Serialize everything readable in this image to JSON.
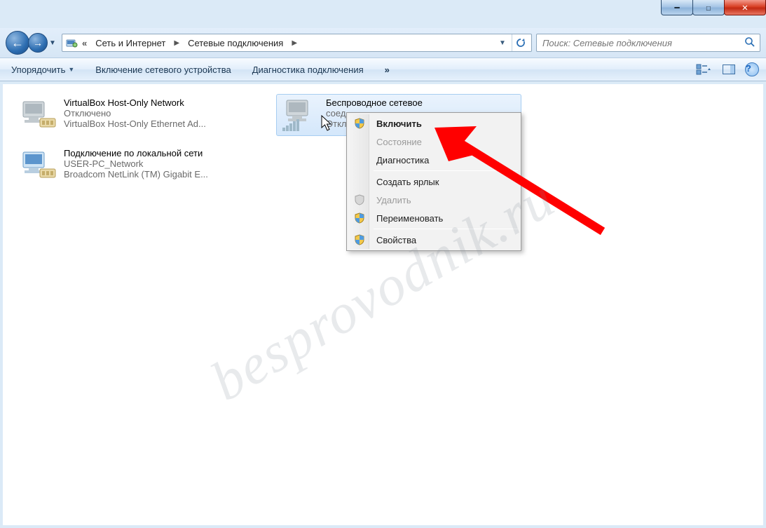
{
  "watermark": "besprovodnik.ru",
  "winctrls": {
    "min": "━",
    "max": "☐",
    "close": "✕"
  },
  "nav": {
    "back_glyph": "←",
    "fwd_glyph": "→",
    "chevrons": "«",
    "crumb1": "Сеть и Интернет",
    "crumb2": "Сетевые подключения"
  },
  "search": {
    "placeholder": "Поиск: Сетевые подключения"
  },
  "toolbar": {
    "organize": "Упорядочить",
    "enable_device": "Включение сетевого устройства",
    "diagnose": "Диагностика подключения",
    "overflow": "»"
  },
  "connections": {
    "vbox": {
      "name": "VirtualBox Host-Only Network",
      "status": "Отключено",
      "device": "VirtualBox Host-Only Ethernet Ad..."
    },
    "lan": {
      "name": "Подключение по локальной сети",
      "status": "USER-PC_Network",
      "device": "Broadcom NetLink (TM) Gigabit E..."
    },
    "wifi": {
      "name": "Беспроводное сетевое",
      "name2": "соед",
      "status": "Откл"
    }
  },
  "menu": {
    "enable": "Включить",
    "state": "Состояние",
    "diag": "Диагностика",
    "shortcut": "Создать ярлык",
    "delete": "Удалить",
    "rename": "Переименовать",
    "props": "Свойства"
  }
}
